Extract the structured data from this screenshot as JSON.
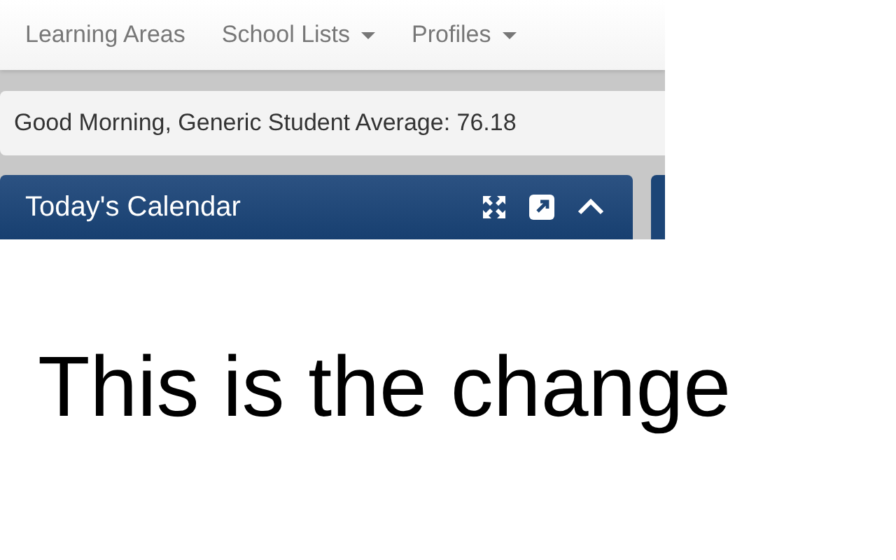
{
  "nav": {
    "items": [
      {
        "label": "Learning Areas",
        "dropdown": false
      },
      {
        "label": "School Lists",
        "dropdown": true
      },
      {
        "label": "Profiles",
        "dropdown": true
      }
    ]
  },
  "greeting": "Good Morning, Generic Student Average: 76.18",
  "panel": {
    "title": "Today's Calendar"
  },
  "caption": "This is the change"
}
